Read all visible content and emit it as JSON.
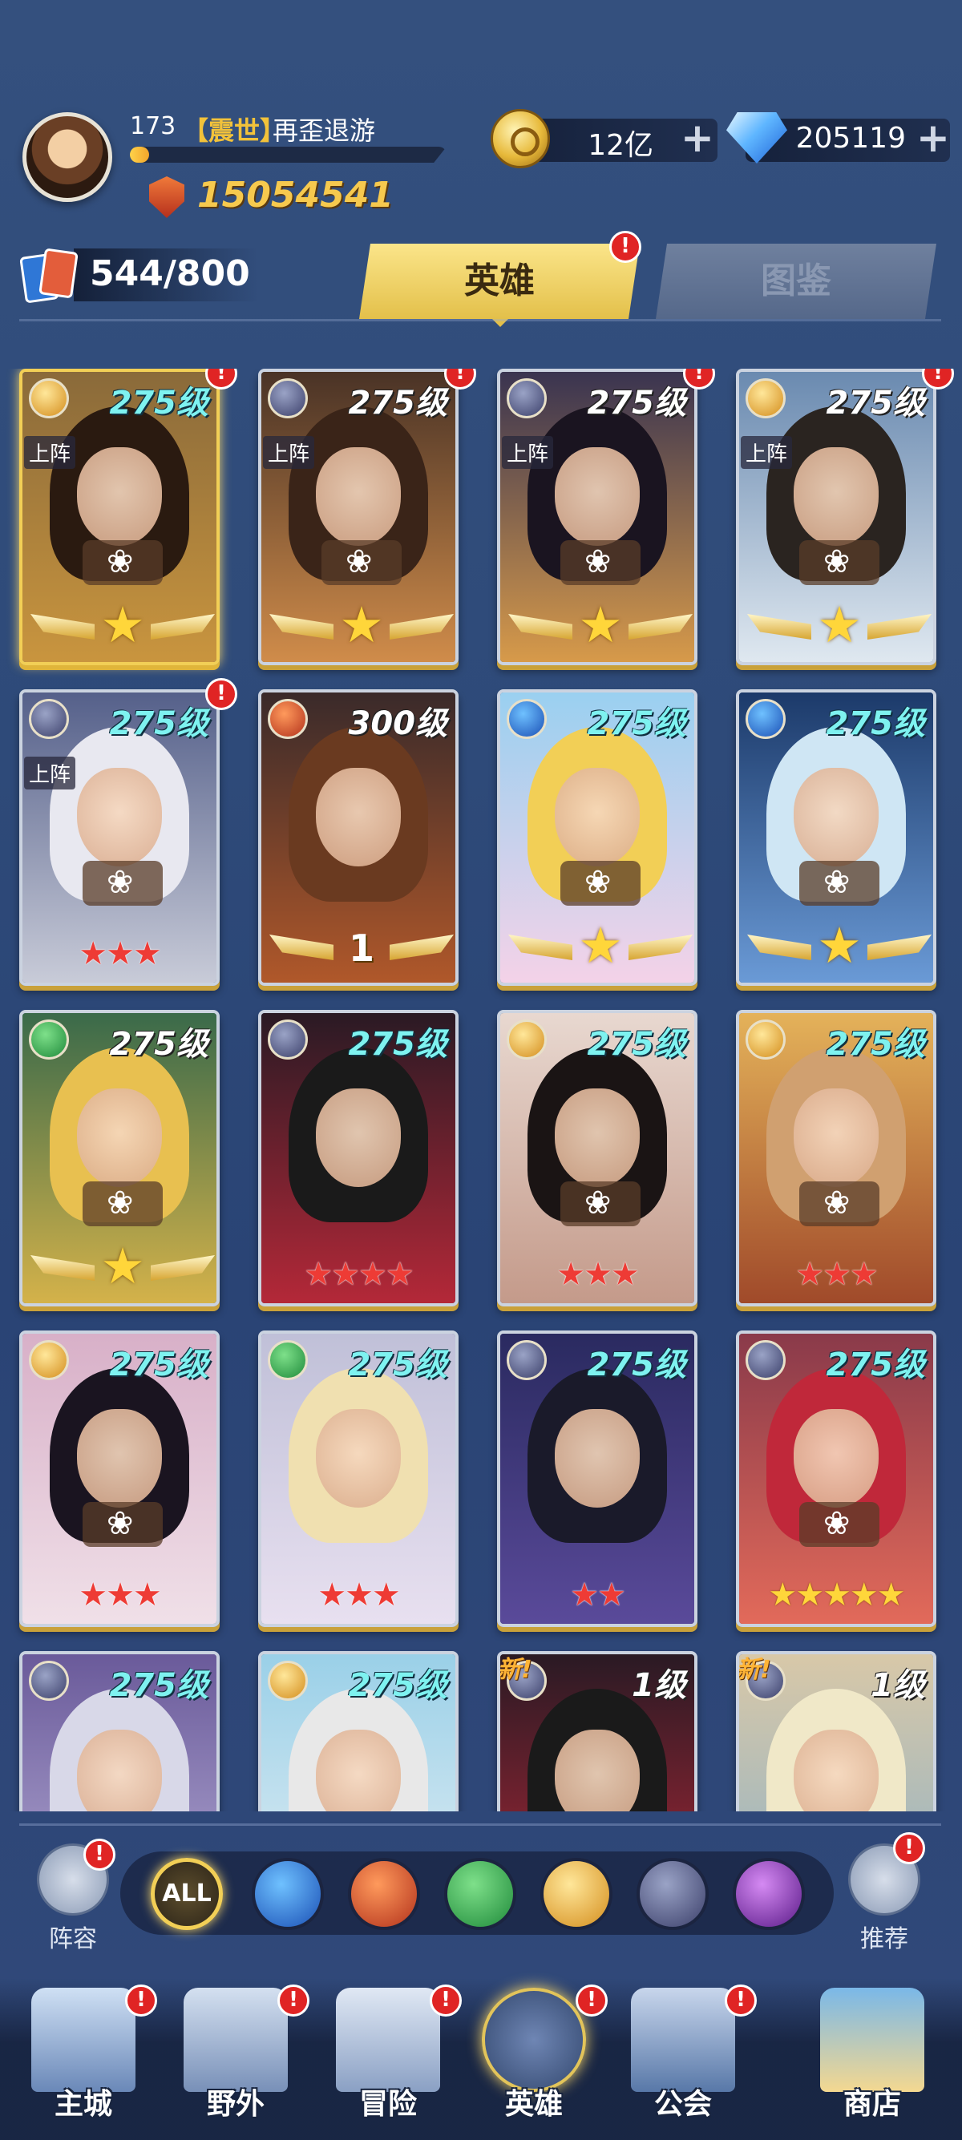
{
  "player": {
    "level": "173",
    "guild": "【震世】",
    "name": "再歪退游",
    "exp_fraction": 0.06,
    "power": "15054541"
  },
  "resources": {
    "gold": "12亿",
    "gems": "205119",
    "gold_icon": "coin-icon",
    "gem_icon": "diamond-icon"
  },
  "hero_count": "544/800",
  "tabs": {
    "heroes": "英雄",
    "codex": "图鉴",
    "badge": "!"
  },
  "heroes": [
    {
      "element": "light",
      "level": "275级",
      "deployed": "上阵",
      "rank": "star-wing",
      "badge": "!"
    },
    {
      "element": "dark",
      "level": "275级",
      "deployed": "上阵",
      "rank": "star-wing",
      "badge": "!"
    },
    {
      "element": "dark",
      "level": "275级",
      "deployed": "上阵",
      "rank": "star-wing",
      "badge": "!"
    },
    {
      "element": "light",
      "level": "275级",
      "deployed": "上阵",
      "rank": "star-wing",
      "badge": "!"
    },
    {
      "element": "dark",
      "level": "275级",
      "deployed": "上阵",
      "rank": "3-red",
      "badge": "!"
    },
    {
      "element": "fire",
      "level": "300级",
      "rank_number": "1",
      "rank": "number-wing"
    },
    {
      "element": "water",
      "level": "275级",
      "rank": "star-wing"
    },
    {
      "element": "water",
      "level": "275级",
      "rank": "star-wing"
    },
    {
      "element": "wind",
      "level": "275级",
      "rank": "star-wing"
    },
    {
      "element": "dark",
      "level": "275级",
      "rank": "4-red"
    },
    {
      "element": "light",
      "level": "275级",
      "rank": "3-red"
    },
    {
      "element": "light",
      "level": "275级",
      "rank": "3-red"
    },
    {
      "element": "light",
      "level": "275级",
      "rank": "3-red"
    },
    {
      "element": "wind",
      "level": "275级",
      "rank": "3-red"
    },
    {
      "element": "dark",
      "level": "275级",
      "rank": "2-red"
    },
    {
      "element": "dark",
      "level": "275级",
      "rank": "5-gold"
    },
    {
      "element": "dark",
      "level": "275级"
    },
    {
      "element": "light",
      "level": "275级"
    },
    {
      "element": "dark",
      "level": "1级",
      "new": "新!"
    },
    {
      "element": "dark",
      "level": "1级",
      "new": "新!"
    }
  ],
  "filters": {
    "all": "ALL",
    "items": [
      "water-element-icon",
      "fire-element-icon",
      "wind-element-icon",
      "light-element-icon",
      "dark-element-icon",
      "void-element-icon"
    ]
  },
  "side_buttons": {
    "lineup": "阵容",
    "recommend": "推荐"
  },
  "nav": {
    "items": [
      "主城",
      "野外",
      "冒险",
      "英雄",
      "公会",
      "商店"
    ],
    "active": "英雄"
  }
}
